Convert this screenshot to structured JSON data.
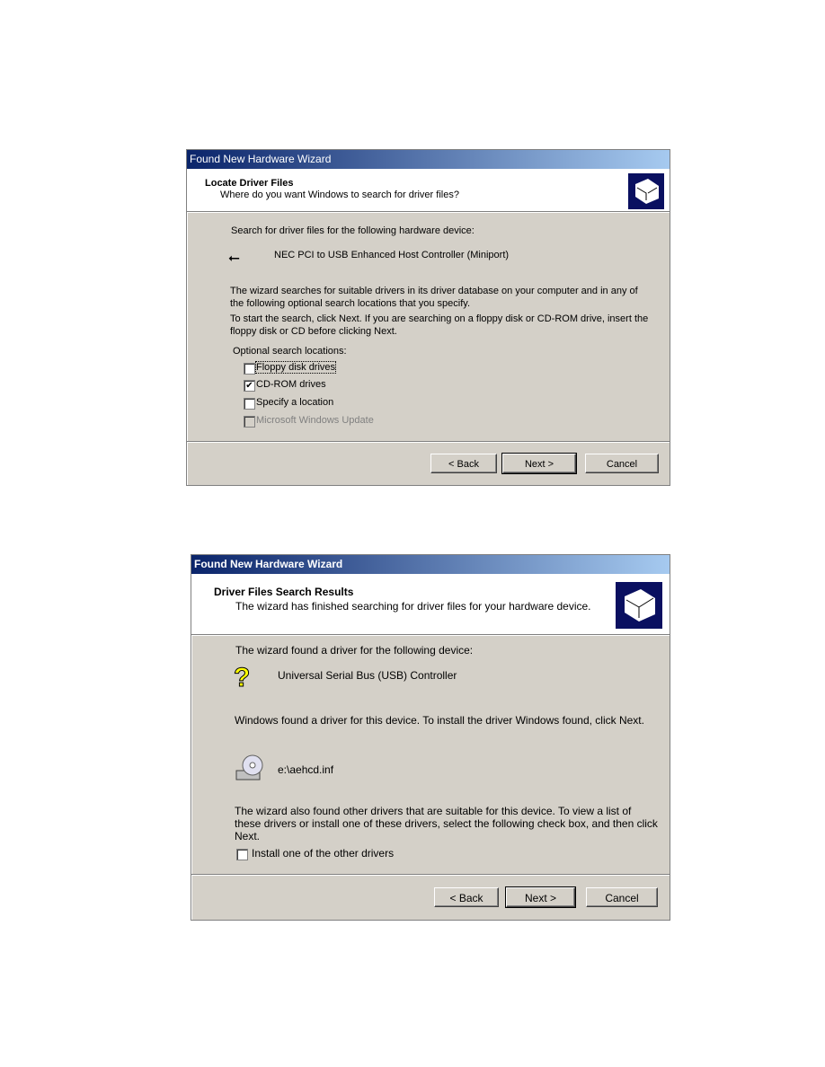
{
  "dialog1": {
    "title": "Found New Hardware Wizard",
    "header_title": "Locate Driver Files",
    "header_subtitle": "Where do you want Windows to search for driver files?",
    "intro": "Search for driver files for the following hardware device:",
    "device_icon": "usb-icon",
    "device_name": "NEC PCI to USB Enhanced Host Controller (Miniport)",
    "para1_line1": "The wizard searches for suitable drivers in its driver database on your computer and in any of",
    "para1_line2": "the following optional search locations that you specify.",
    "para2_line1": "To start the search, click Next. If you are searching on a floppy disk or CD-ROM drive, insert the",
    "para2_line2": "floppy disk or CD before clicking Next.",
    "options_label": "Optional search locations:",
    "options": [
      {
        "label": "Floppy disk drives",
        "checked": false,
        "enabled": true
      },
      {
        "label": "CD-ROM drives",
        "checked": true,
        "enabled": true
      },
      {
        "label": "Specify a location",
        "checked": false,
        "enabled": true
      },
      {
        "label": "Microsoft Windows Update",
        "checked": false,
        "enabled": false
      }
    ],
    "buttons": {
      "back": "< Back",
      "next": "Next >",
      "cancel": "Cancel"
    }
  },
  "dialog2": {
    "title": "Found New Hardware Wizard",
    "header_title": "Driver Files Search Results",
    "header_subtitle": "The wizard has finished searching for driver files for your hardware device.",
    "intro": "The wizard found a driver for the following device:",
    "device_icon": "question-mark-icon",
    "device_name": "Universal Serial Bus (USB) Controller",
    "found_text": "Windows found a driver for this device. To install the driver Windows found, click Next.",
    "file_icon": "cd-drive-icon",
    "driver_file": "e:\\aehcd.inf",
    "other_line1": "The wizard also found other drivers that are suitable for this device. To view a list of",
    "other_line2": "these drivers or install one of these drivers, select the following check box, and then click",
    "other_line3": "Next.",
    "checkbox_label": "Install one of the other drivers",
    "checkbox_checked": false,
    "buttons": {
      "back": "< Back",
      "next": "Next >",
      "cancel": "Cancel"
    }
  }
}
